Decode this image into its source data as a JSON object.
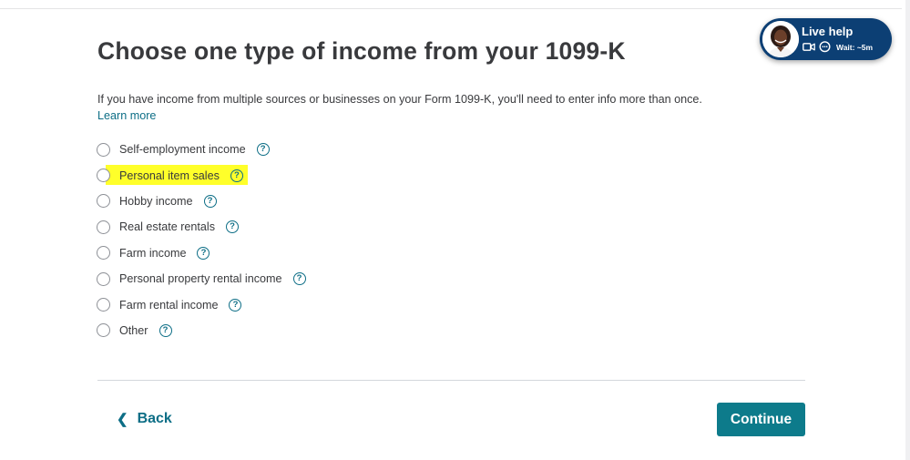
{
  "page": {
    "title": "Choose one type of income from your 1099-K",
    "intro": "If you have income from multiple sources or businesses on your Form 1099-K, you'll need to enter info more than once.",
    "learn_more": "Learn more"
  },
  "options": [
    {
      "label": "Self-employment income",
      "help_glyph": "?"
    },
    {
      "label": "Personal item sales",
      "help_glyph": "?"
    },
    {
      "label": "Hobby income",
      "help_glyph": "?"
    },
    {
      "label": "Real estate rentals",
      "help_glyph": "?"
    },
    {
      "label": "Farm income",
      "help_glyph": "?"
    },
    {
      "label": "Personal property rental income",
      "help_glyph": "?"
    },
    {
      "label": "Farm rental income",
      "help_glyph": "?"
    },
    {
      "label": "Other",
      "help_glyph": "?"
    }
  ],
  "footer": {
    "back_label": "Back",
    "back_icon": "chevron-left-icon",
    "continue_label": "Continue"
  },
  "live_help": {
    "title": "Live help",
    "wait": "Wait: ~5m",
    "icons": [
      "video-icon",
      "chat-icon"
    ]
  },
  "colors": {
    "accent": "#0d6e86",
    "continue_bg": "#0d7b8b",
    "live_help_bg": "#0c3f74",
    "highlight": "#ffff2a"
  }
}
